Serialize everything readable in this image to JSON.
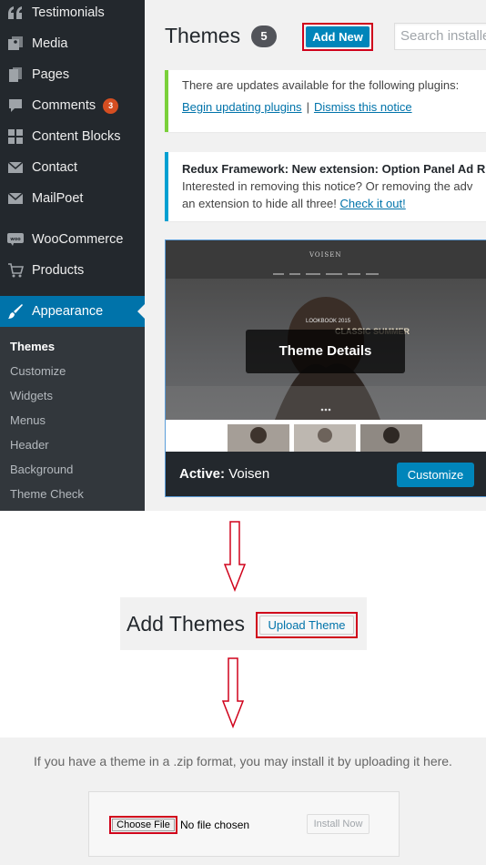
{
  "sidebar": {
    "items": [
      {
        "label": "Testimonials",
        "icon": "quote-icon"
      },
      {
        "label": "Media",
        "icon": "media-icon"
      },
      {
        "label": "Pages",
        "icon": "pages-icon"
      },
      {
        "label": "Comments",
        "icon": "comments-icon",
        "badge": "3"
      },
      {
        "label": "Content Blocks",
        "icon": "blocks-icon"
      },
      {
        "label": "Contact",
        "icon": "envelope-icon"
      },
      {
        "label": "MailPoet",
        "icon": "envelope-icon"
      },
      {
        "label": "WooCommerce",
        "icon": "woo-icon"
      },
      {
        "label": "Products",
        "icon": "cart-icon"
      },
      {
        "label": "Appearance",
        "icon": "brush-icon",
        "active": true
      }
    ],
    "submenu": [
      "Themes",
      "Customize",
      "Widgets",
      "Menus",
      "Header",
      "Background",
      "Theme Check"
    ]
  },
  "themes_page": {
    "title": "Themes",
    "count": "5",
    "add_new_label": "Add New",
    "search_placeholder": "Search installed"
  },
  "notices": {
    "updates": {
      "text": "There are updates available for the following plugins:",
      "begin_link": "Begin updating plugins",
      "separator": "|",
      "dismiss_link": "Dismiss this notice"
    },
    "redux": {
      "title": "Redux Framework: New extension: Option Panel Ad R",
      "line2": "Interested in removing this notice? Or removing the adv",
      "line3_prefix": "an extension to hide all three!",
      "check_link": "Check it out!"
    }
  },
  "theme_card": {
    "details_label": "Theme Details",
    "active_prefix": "Active:",
    "active_name": "Voisen",
    "customize_label": "Customize",
    "preview_logo": "VOISEN",
    "preview_headline": "LOOKBOOK 2015",
    "preview_banner": "CLASSIC SUMMER"
  },
  "add_themes": {
    "title": "Add Themes",
    "upload_label": "Upload Theme"
  },
  "upload": {
    "help_text": "If you have a theme in a .zip format, you may install it by uploading it here.",
    "choose_label": "Choose File",
    "no_file_label": "No file chosen",
    "install_label": "Install Now"
  },
  "colors": {
    "sidebar_bg": "#23282d",
    "accent": "#0073aa",
    "button_blue": "#0085ba",
    "highlight_red": "#d0021b",
    "badge": "#d54e21"
  }
}
